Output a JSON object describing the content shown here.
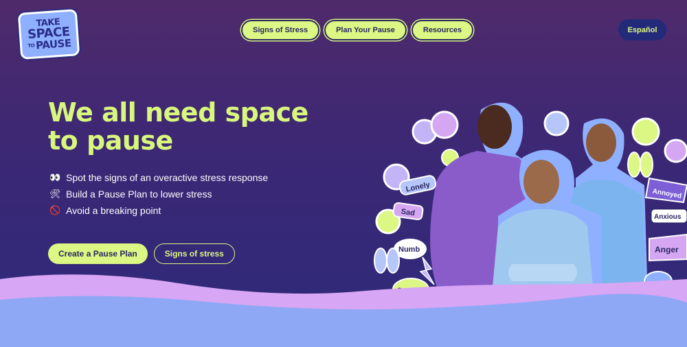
{
  "logo": {
    "line1": "TAKE",
    "line2": "SPACE",
    "line3_prefix": "TO",
    "line3": "PAUSE"
  },
  "nav": {
    "items": [
      "Signs of Stress",
      "Plan Your Pause",
      "Resources"
    ],
    "language": "Español"
  },
  "hero": {
    "title": "We all need space to pause",
    "bullets": [
      {
        "icon": "eyes-icon",
        "glyph": "👀",
        "text": "Spot the signs of an overactive stress response"
      },
      {
        "icon": "tools-icon",
        "glyph": "🛠",
        "text": "Build a Pause Plan to lower stress"
      },
      {
        "icon": "no-entry-icon",
        "glyph": "🚫",
        "text": "Avoid a breaking point"
      }
    ],
    "primary_cta": "Create a Pause Plan",
    "secondary_cta": "Signs of stress"
  },
  "stickers": [
    "Lonely",
    "Sad",
    "Numb",
    "Overwhe",
    "Annoyed",
    "Anxious",
    "Anger"
  ],
  "colors": {
    "accent": "#dcf783",
    "navy": "#232a7a",
    "bg_top": "#4f2a6b",
    "wave_pink": "#d7a6f5",
    "wave_blue": "#8fa8f5"
  }
}
